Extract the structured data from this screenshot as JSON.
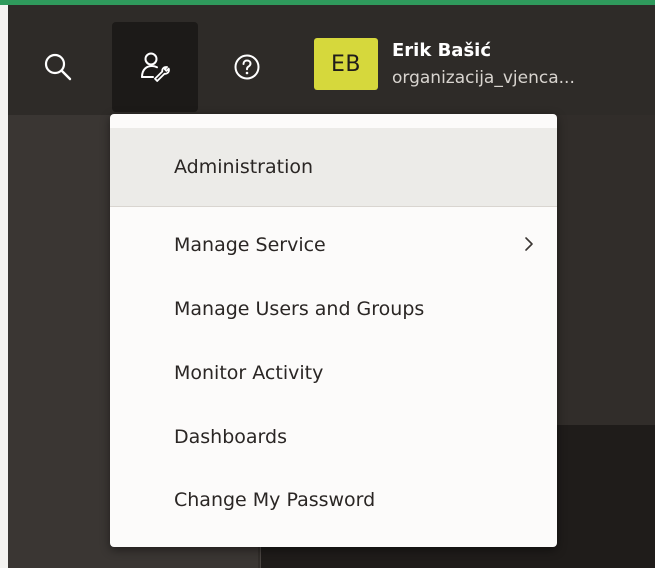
{
  "header": {
    "user": {
      "initials": "EB",
      "name": "Erik Bašić",
      "org": "organizacija_vjenca..."
    },
    "icons": [
      "search-icon",
      "tools-icon",
      "help-icon"
    ]
  },
  "menu": {
    "header_label": "Administration",
    "items": [
      {
        "label": "Manage Service",
        "has_submenu": true
      },
      {
        "label": "Manage Users and Groups"
      },
      {
        "label": "Monitor Activity"
      },
      {
        "label": "Dashboards"
      },
      {
        "label": "Change My Password"
      }
    ]
  },
  "colors": {
    "accent": "#2f9a5c",
    "header_bg": "#2e2b28",
    "avatar_bg": "#d6d83c",
    "menu_bg": "#fcfbfa",
    "menu_header_bg": "#ecebe8"
  }
}
